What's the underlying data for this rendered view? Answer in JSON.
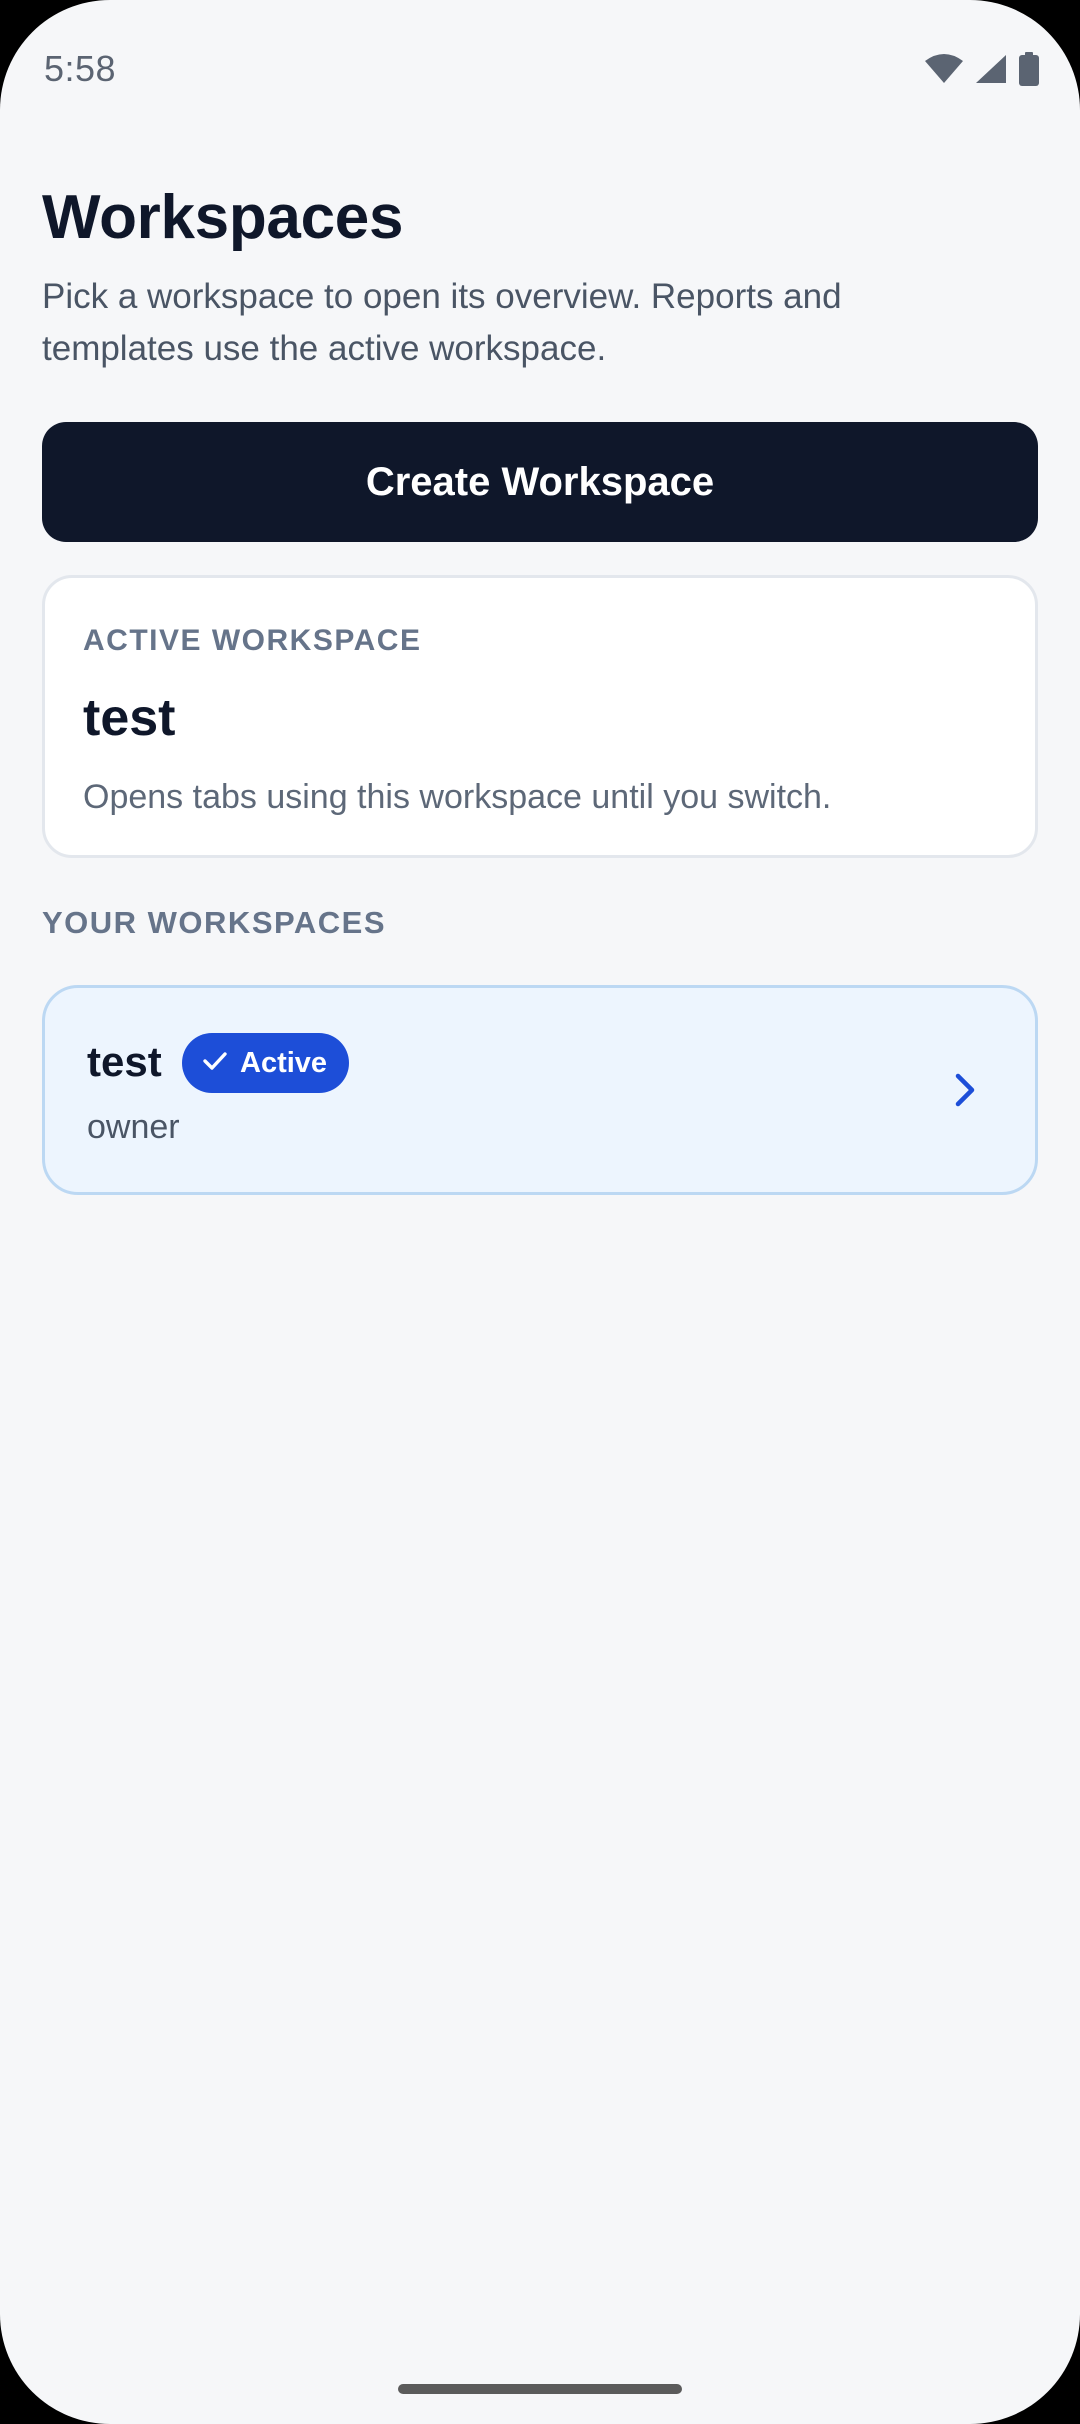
{
  "status_bar": {
    "time": "5:58",
    "icons": [
      "wifi-icon",
      "signal-icon",
      "battery-icon"
    ]
  },
  "header": {
    "title": "Workspaces",
    "subtitle": "Pick a workspace to open its overview. Reports and templates use the active workspace."
  },
  "actions": {
    "create_label": "Create Workspace"
  },
  "active_workspace": {
    "label": "ACTIVE WORKSPACE",
    "name": "test",
    "description": "Opens tabs using this workspace until you switch."
  },
  "workspaces": {
    "section_label": "YOUR WORKSPACES",
    "items": [
      {
        "name": "test",
        "badge": "Active",
        "role": "owner"
      }
    ]
  },
  "colors": {
    "primary_dark": "#0f172a",
    "accent_blue": "#1d4ed8",
    "active_row_bg": "#edf5fe",
    "background": "#f6f7f9"
  }
}
